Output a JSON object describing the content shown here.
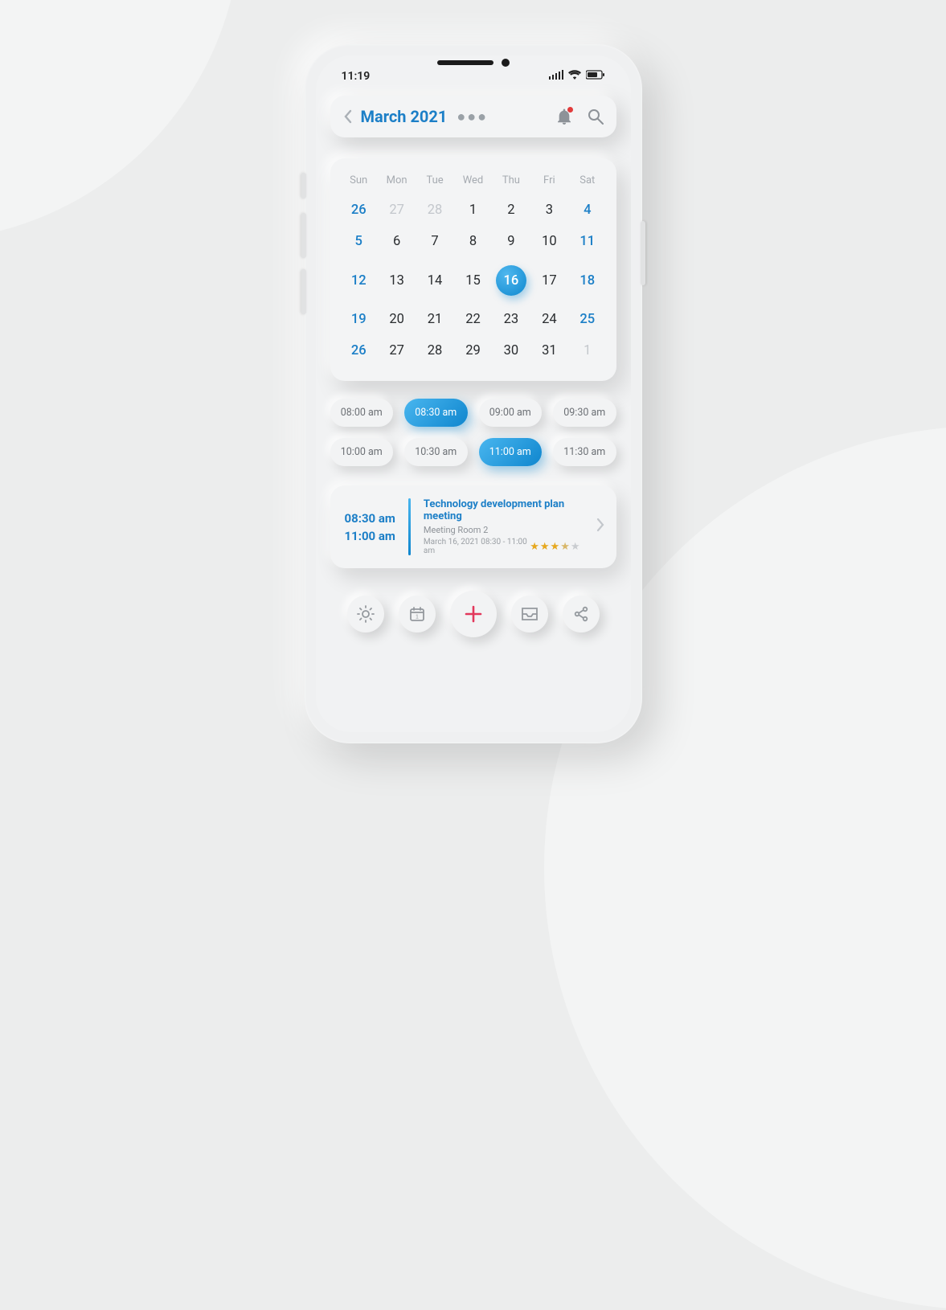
{
  "status": {
    "time": "11:19"
  },
  "header": {
    "month_label": "March 2021"
  },
  "calendar": {
    "dow": [
      "Sun",
      "Mon",
      "Tue",
      "Wed",
      "Thu",
      "Fri",
      "Sat"
    ],
    "days": [
      {
        "n": "26",
        "cls": "highlight muted"
      },
      {
        "n": "27",
        "cls": "muted"
      },
      {
        "n": "28",
        "cls": "muted"
      },
      {
        "n": "1",
        "cls": ""
      },
      {
        "n": "2",
        "cls": ""
      },
      {
        "n": "3",
        "cls": ""
      },
      {
        "n": "4",
        "cls": "highlight"
      },
      {
        "n": "5",
        "cls": "highlight"
      },
      {
        "n": "6",
        "cls": ""
      },
      {
        "n": "7",
        "cls": ""
      },
      {
        "n": "8",
        "cls": ""
      },
      {
        "n": "9",
        "cls": ""
      },
      {
        "n": "10",
        "cls": ""
      },
      {
        "n": "11",
        "cls": "highlight"
      },
      {
        "n": "12",
        "cls": "highlight"
      },
      {
        "n": "13",
        "cls": ""
      },
      {
        "n": "14",
        "cls": ""
      },
      {
        "n": "15",
        "cls": ""
      },
      {
        "n": "16",
        "cls": "selected"
      },
      {
        "n": "17",
        "cls": ""
      },
      {
        "n": "18",
        "cls": "highlight"
      },
      {
        "n": "19",
        "cls": "highlight"
      },
      {
        "n": "20",
        "cls": ""
      },
      {
        "n": "21",
        "cls": ""
      },
      {
        "n": "22",
        "cls": ""
      },
      {
        "n": "23",
        "cls": ""
      },
      {
        "n": "24",
        "cls": ""
      },
      {
        "n": "25",
        "cls": "highlight"
      },
      {
        "n": "26",
        "cls": "highlight"
      },
      {
        "n": "27",
        "cls": ""
      },
      {
        "n": "28",
        "cls": ""
      },
      {
        "n": "29",
        "cls": ""
      },
      {
        "n": "30",
        "cls": ""
      },
      {
        "n": "31",
        "cls": ""
      },
      {
        "n": "1",
        "cls": "muted"
      }
    ]
  },
  "slots": [
    {
      "label": "08:00 am",
      "active": false
    },
    {
      "label": "08:30 am",
      "active": true
    },
    {
      "label": "09:00 am",
      "active": false
    },
    {
      "label": "09:30 am",
      "active": false
    },
    {
      "label": "10:00 am",
      "active": false
    },
    {
      "label": "10:30 am",
      "active": false
    },
    {
      "label": "11:00 am",
      "active": true
    },
    {
      "label": "11:30 am",
      "active": false
    }
  ],
  "event": {
    "start": "08:30 am",
    "end": "11:00 am",
    "title": "Technology development plan meeting",
    "room": "Meeting Room 2",
    "dateline": "March 16, 2021 08:30 - 11:00 am",
    "rating": 3.5
  },
  "colors": {
    "accent": "#1c7fc7"
  }
}
